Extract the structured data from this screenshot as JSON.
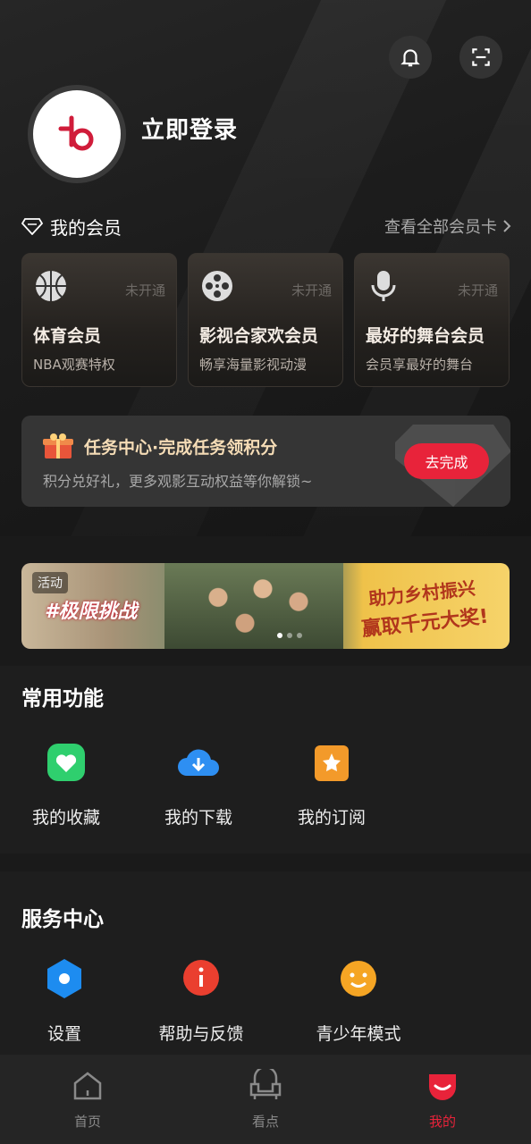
{
  "header": {
    "bell_icon": "bell-icon",
    "scan_icon": "scan-icon",
    "login_text": "立即登录"
  },
  "membership": {
    "title": "我的会员",
    "view_all": "查看全部会员卡",
    "cards": [
      {
        "icon": "basketball-icon",
        "status": "未开通",
        "name": "体育会员",
        "desc": "NBA观赛特权"
      },
      {
        "icon": "film-reel-icon",
        "status": "未开通",
        "name": "影视合家欢会员",
        "desc": "畅享海量影视动漫"
      },
      {
        "icon": "microphone-icon",
        "status": "未开通",
        "name": "最好的舞台会员",
        "desc": "会员享最好的舞台"
      }
    ]
  },
  "task": {
    "title": "任务中心·完成任务领积分",
    "subtitle": "积分兑好礼，更多观影互动权益等你解锁~",
    "button": "去完成"
  },
  "banner": {
    "tag": "活动",
    "left_title": "#极限挑战",
    "right_line1": "助力乡村振兴",
    "right_line2": "赢取千元大奖!",
    "dots": 3,
    "active_dot": 0
  },
  "common_functions": {
    "title": "常用功能",
    "items": [
      {
        "label": "我的收藏",
        "icon": "heart-icon"
      },
      {
        "label": "我的下载",
        "icon": "download-cloud-icon"
      },
      {
        "label": "我的订阅",
        "icon": "star-icon"
      }
    ]
  },
  "service_center": {
    "title": "服务中心",
    "items": [
      {
        "label": "设置",
        "icon": "settings-icon"
      },
      {
        "label": "帮助与反馈",
        "icon": "info-icon"
      },
      {
        "label": "青少年模式",
        "icon": "smiley-icon"
      }
    ]
  },
  "tabbar": {
    "items": [
      {
        "label": "首页",
        "icon": "home-icon",
        "active": false
      },
      {
        "label": "看点",
        "icon": "sofa-icon",
        "active": false
      },
      {
        "label": "我的",
        "icon": "profile-icon",
        "active": true
      }
    ]
  },
  "colors": {
    "accent": "#e8233a",
    "background": "#1a1a1a",
    "card_gold": "#f5dcb6"
  }
}
